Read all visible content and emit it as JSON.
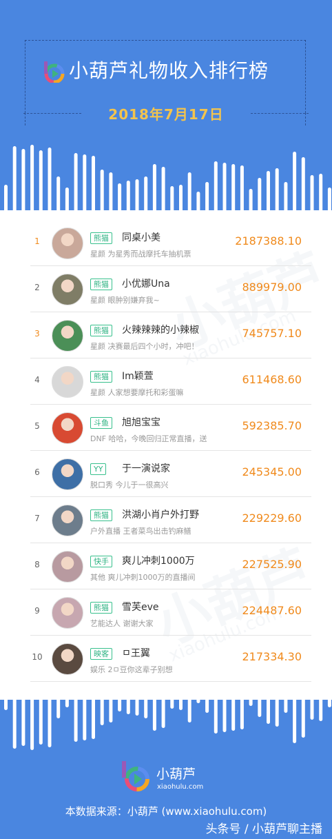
{
  "header": {
    "title": "小葫芦礼物收入排行榜",
    "date": "2018年7月17日"
  },
  "ranking": [
    {
      "rank": "1",
      "platform": "熊猫",
      "name": "同桌小美",
      "category": "星颜",
      "desc": "星颜 为星秀而战摩托车抽机票",
      "amount": "2187388.10",
      "avatar_color": "#c9a89a"
    },
    {
      "rank": "2",
      "platform": "熊猫",
      "name": "小优娜Una",
      "category": "星颜",
      "desc": "星颜 眼肿别嫌弃我~",
      "amount": "889979.00",
      "avatar_color": "#7f7d66"
    },
    {
      "rank": "3",
      "platform": "熊猫",
      "name": "火辣辣辣的小辣椒",
      "category": "星颜",
      "desc": "星颜 决赛最后四个小时，冲吧！",
      "amount": "745757.10",
      "avatar_color": "#4b8f57"
    },
    {
      "rank": "4",
      "platform": "熊猫",
      "name": "Im颖萱",
      "category": "星颜",
      "desc": "星颜 人家想要摩托和彩蛋嘛",
      "amount": "611468.60",
      "avatar_color": "#d8d8d8"
    },
    {
      "rank": "5",
      "platform": "斗鱼",
      "name": "旭旭宝宝",
      "category": "DNF",
      "desc": "DNF 哈哈，今晚回归正常直播，送",
      "amount": "592385.70",
      "avatar_color": "#d84a32"
    },
    {
      "rank": "6",
      "platform": "YY",
      "name": "于一演说家",
      "category": "脱口秀",
      "desc": "脱口秀 今儿于一很高兴",
      "amount": "245345.00",
      "avatar_color": "#3e6fa6"
    },
    {
      "rank": "7",
      "platform": "熊猫",
      "name": "洪湖小肖户外打野",
      "category": "户外直播",
      "desc": "户外直播 王者菜鸟出击钓麻鳝",
      "amount": "229229.60",
      "avatar_color": "#6d7d8c"
    },
    {
      "rank": "8",
      "platform": "快手",
      "name": "爽儿冲刺1000万",
      "category": "其他",
      "desc": "其他 爽儿冲刺1000万的直播间",
      "amount": "227525.90",
      "avatar_color": "#b89aa0"
    },
    {
      "rank": "9",
      "platform": "熊猫",
      "name": "雪芙eve",
      "category": "艺能达人",
      "desc": "艺能达人 谢谢大家",
      "amount": "224487.60",
      "avatar_color": "#c7a7b0"
    },
    {
      "rank": "10",
      "platform": "映客",
      "name": "ㅁ王翼",
      "category": "娱乐",
      "desc": "娱乐 2ㅁ豆你这辈子别想",
      "amount": "217334.30",
      "avatar_color": "#5a4a40"
    }
  ],
  "watermark": {
    "text": "小葫芦",
    "url": "xiaohulu.com"
  },
  "footer": {
    "brand": "小葫芦",
    "url": "xiaohulu.com",
    "source": "本数据来源：小葫芦 (www.xiaohulu.com)",
    "credit": "头条号 / 小葫芦聊主播"
  },
  "colors": {
    "background": "#4a86e0",
    "accent": "#f08a1c",
    "date": "#f3c44d",
    "tag": "#2fb383"
  }
}
